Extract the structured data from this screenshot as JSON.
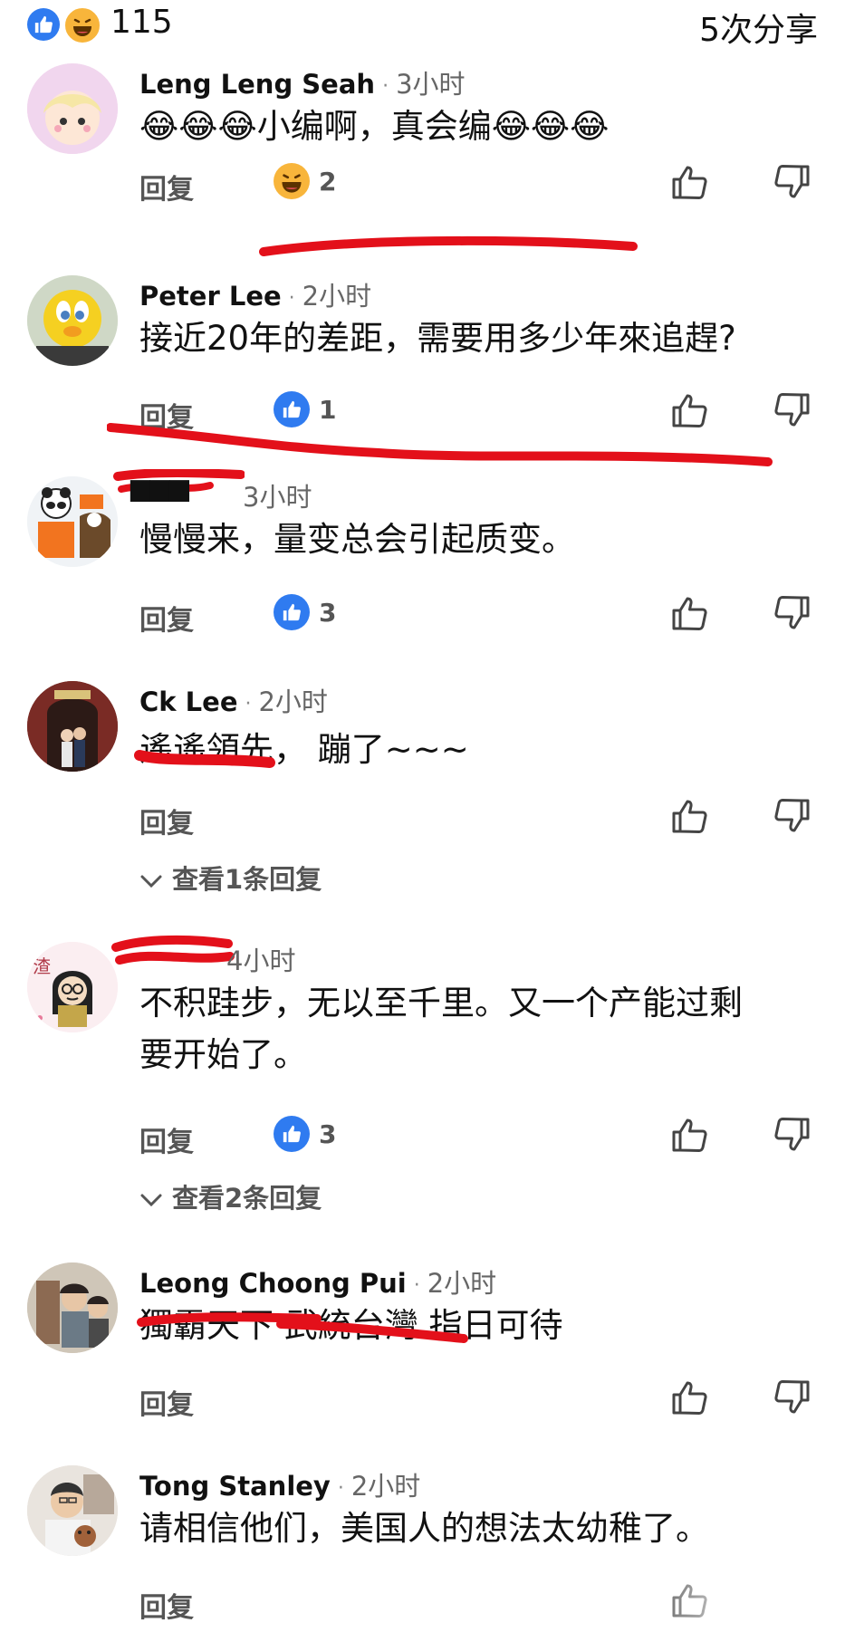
{
  "header": {
    "reaction_count": "115",
    "share_count": "5次分享"
  },
  "colors": {
    "like_blue": "#2f7bf0",
    "laugh_yellow": "#f8b53b",
    "red_annotation": "#e3101a"
  },
  "comments": [
    {
      "author": "Leng Leng Seah",
      "time": "3小时",
      "text": "😂😂😂小编啊，真会编😂😂😂",
      "reply_label": "回复",
      "reaction_type": "haha",
      "reaction_count": "2"
    },
    {
      "author": "Peter Lee",
      "time": "2小时",
      "text": "接近20年的差距，需要用多少年來追趕?",
      "reply_label": "回复",
      "reaction_type": "like",
      "reaction_count": "1"
    },
    {
      "author": "",
      "time": "3小时",
      "text": "慢慢来，量变总会引起质变。",
      "reply_label": "回复",
      "reaction_type": "like",
      "reaction_count": "3"
    },
    {
      "author": "Ck Lee",
      "time": "2小时",
      "text": "遙遙領先，  蹦了~~~",
      "reply_label": "回复",
      "view_replies": "查看1条回复"
    },
    {
      "author": "",
      "time": "4小时",
      "text_line1": "不积跬步，无以至千里。又一个产能过剩",
      "text_line2": "要开始了。",
      "reply_label": "回复",
      "reaction_type": "like",
      "reaction_count": "3",
      "view_replies": "查看2条回复"
    },
    {
      "author": "Leong Choong Pui",
      "time": "2小时",
      "text": "獨霸天下 武統台灣 指日可待",
      "reply_label": "回复"
    },
    {
      "author": "Tong Stanley",
      "time": "2小时",
      "text": "请相信他们，美国人的想法太幼稚了。",
      "reply_label": "回复"
    }
  ]
}
